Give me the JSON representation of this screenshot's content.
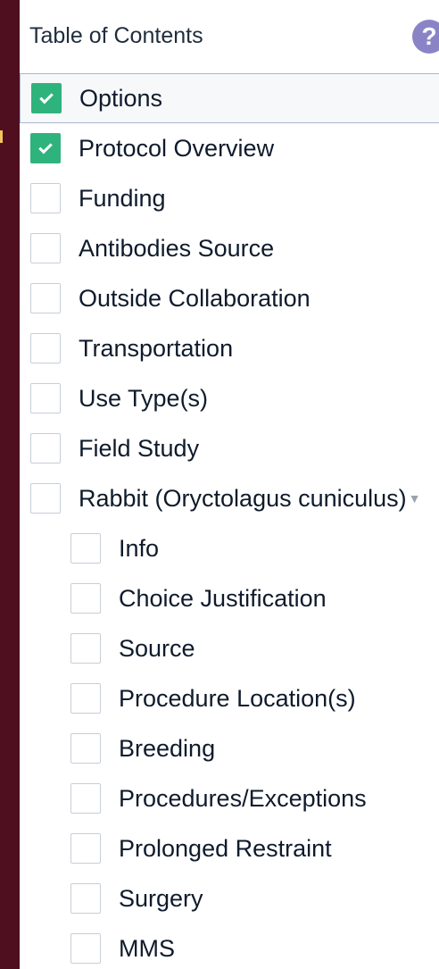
{
  "panel": {
    "title": "Table of Contents",
    "help_icon": "?"
  },
  "items": [
    {
      "label": "Options",
      "checked": true,
      "selected": true,
      "indent": 0
    },
    {
      "label": "Protocol Overview",
      "checked": true,
      "selected": false,
      "indent": 0
    },
    {
      "label": "Funding",
      "checked": false,
      "selected": false,
      "indent": 0
    },
    {
      "label": "Antibodies Source",
      "checked": false,
      "selected": false,
      "indent": 0
    },
    {
      "label": "Outside Collaboration",
      "checked": false,
      "selected": false,
      "indent": 0
    },
    {
      "label": "Transportation",
      "checked": false,
      "selected": false,
      "indent": 0
    },
    {
      "label": "Use Type(s)",
      "checked": false,
      "selected": false,
      "indent": 0
    },
    {
      "label": "Field Study",
      "checked": false,
      "selected": false,
      "indent": 0
    },
    {
      "label": "Rabbit (Oryctolagus cuniculus)",
      "checked": false,
      "selected": false,
      "indent": 0,
      "expanded": true
    },
    {
      "label": "Info",
      "checked": false,
      "selected": false,
      "indent": 1
    },
    {
      "label": "Choice Justification",
      "checked": false,
      "selected": false,
      "indent": 1
    },
    {
      "label": "Source",
      "checked": false,
      "selected": false,
      "indent": 1
    },
    {
      "label": "Procedure Location(s)",
      "checked": false,
      "selected": false,
      "indent": 1
    },
    {
      "label": "Breeding",
      "checked": false,
      "selected": false,
      "indent": 1
    },
    {
      "label": "Procedures/Exceptions",
      "checked": false,
      "selected": false,
      "indent": 1
    },
    {
      "label": "Prolonged Restraint",
      "checked": false,
      "selected": false,
      "indent": 1
    },
    {
      "label": "Surgery",
      "checked": false,
      "selected": false,
      "indent": 1
    },
    {
      "label": "MMS",
      "checked": false,
      "selected": false,
      "indent": 1
    }
  ],
  "icons": {
    "check": "checkmark-icon",
    "caret": "caret-down-icon",
    "help": "question-circle-icon"
  },
  "colors": {
    "background": "#4f0f1f",
    "panel": "#ffffff",
    "checked": "#2fb37d",
    "help": "#8a84c7"
  }
}
